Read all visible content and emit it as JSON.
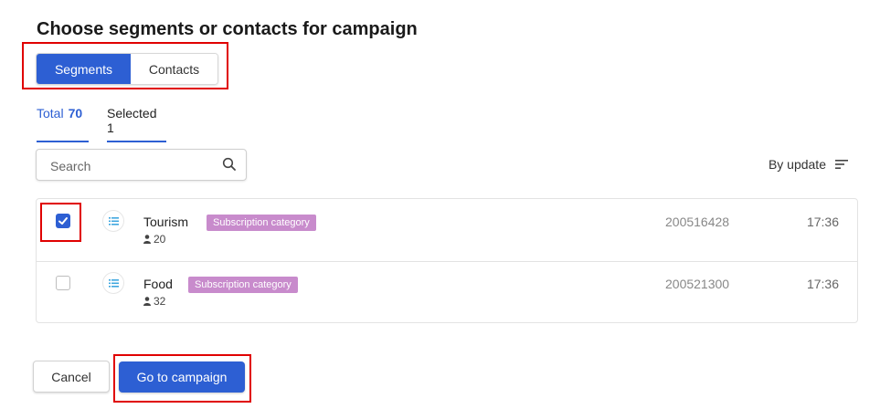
{
  "page": {
    "title": "Choose segments or contacts for campaign"
  },
  "toggle": {
    "segments_label": "Segments",
    "contacts_label": "Contacts"
  },
  "tabs": {
    "total_label": "Total",
    "total_count": "70",
    "selected_label": "Selected 1"
  },
  "search": {
    "placeholder": "Search"
  },
  "sort": {
    "label": "By update"
  },
  "rows": [
    {
      "name": "Tourism",
      "tag": "Subscription category",
      "members": "20",
      "id": "200516428",
      "time": "17:36",
      "checked": true
    },
    {
      "name": "Food",
      "tag": "Subscription category",
      "members": "32",
      "id": "200521300",
      "time": "17:36",
      "checked": false
    }
  ],
  "footer": {
    "cancel_label": "Cancel",
    "go_label": "Go to campaign"
  },
  "colors": {
    "accent": "#2d5fd3",
    "tag": "#c88bcc",
    "highlight": "#e00000"
  }
}
